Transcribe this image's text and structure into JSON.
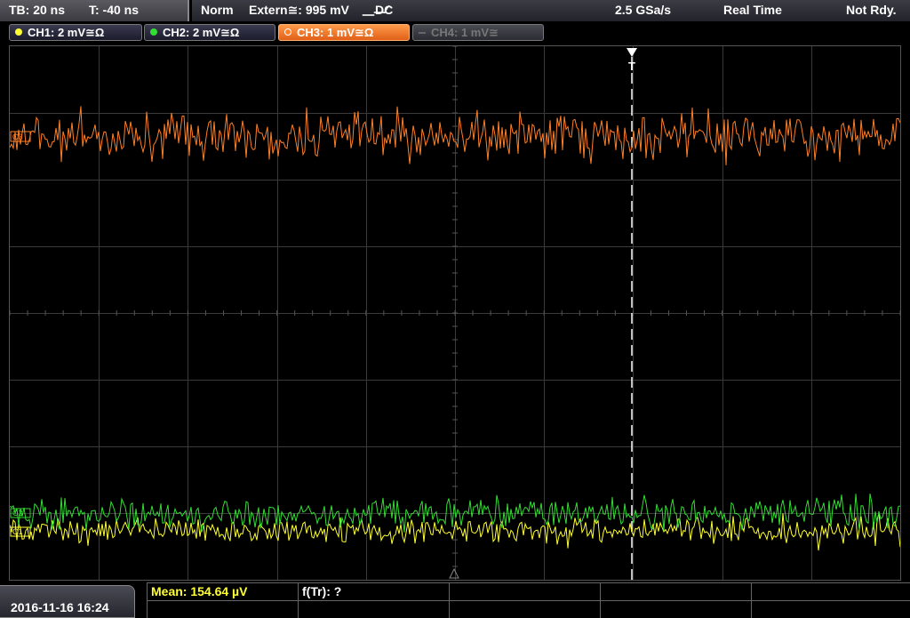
{
  "status_bar": {
    "timebase": "TB: 20 ns",
    "trigger_offset": "T: -40 ns",
    "trigger_mode": "Norm",
    "trigger_source": "Extern≅: 995 mV",
    "trigger_slope": "DC",
    "sample_rate": "2.5 GSa/s",
    "acquisition": "Real Time",
    "run_state": "Not Rdy."
  },
  "channels": [
    {
      "label": "CH1: 2 mV≅Ω",
      "color": "#ffff33",
      "active": true
    },
    {
      "label": "CH2: 2 mV≅Ω",
      "color": "#33dd33",
      "active": true
    },
    {
      "label": "CH3: 1 mV≅Ω",
      "color": "#ff7f27",
      "active": true,
      "selected": true
    },
    {
      "label": "CH4: 1 mV≅",
      "color": "#555555",
      "active": false
    }
  ],
  "screen": {
    "trigger_marker": "T",
    "ch3_marker": "C3",
    "ch2_marker": "C2",
    "ch1_marker": "C1",
    "grid_color": "#3a3a3a",
    "trigger_line_color": "#ffffff"
  },
  "bottom_bar": {
    "datetime": "2016-11-16 16:24",
    "measurement_mean": "Mean: 154.64 µV",
    "measurement_ftr": "f(Tr): ?"
  }
}
